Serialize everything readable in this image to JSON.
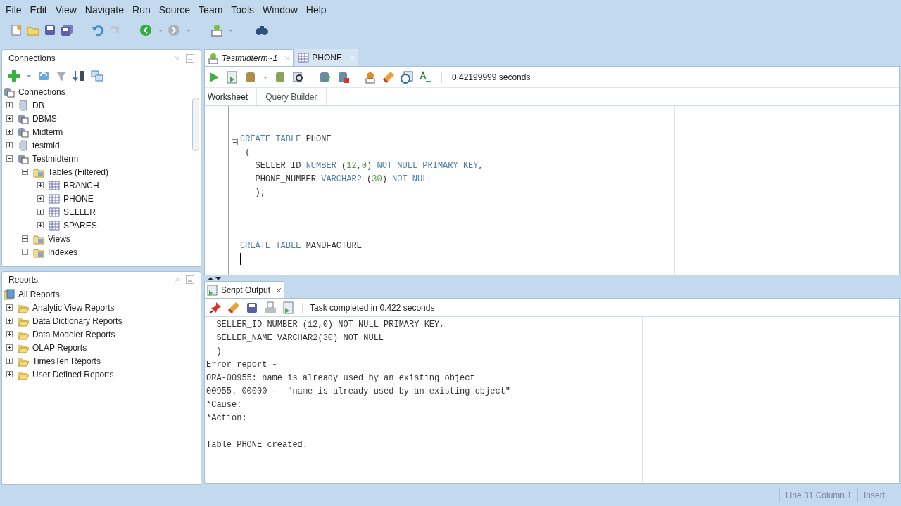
{
  "menu": [
    "File",
    "Edit",
    "View",
    "Navigate",
    "Run",
    "Source",
    "Team",
    "Tools",
    "Window",
    "Help"
  ],
  "connections_panel": {
    "title": "Connections",
    "tree": [
      {
        "label": "Connections",
        "kind": "conn",
        "children": [
          {
            "label": "DB",
            "kind": "db",
            "expanded": false
          },
          {
            "label": "DBMS",
            "kind": "conn",
            "expanded": false
          },
          {
            "label": "Midterm",
            "kind": "conn",
            "expanded": false
          },
          {
            "label": "testmid",
            "kind": "db",
            "expanded": false
          },
          {
            "label": "Testmidterm",
            "kind": "conn",
            "expanded": true,
            "children": [
              {
                "label": "Tables (Filtered)",
                "kind": "folder",
                "expanded": true,
                "children": [
                  {
                    "label": "BRANCH",
                    "kind": "table",
                    "expanded": false
                  },
                  {
                    "label": "PHONE",
                    "kind": "table",
                    "expanded": false
                  },
                  {
                    "label": "SELLER",
                    "kind": "table",
                    "expanded": false
                  },
                  {
                    "label": "SPARES",
                    "kind": "table",
                    "expanded": false
                  }
                ]
              },
              {
                "label": "Views",
                "kind": "folder",
                "expanded": false
              },
              {
                "label": "Indexes",
                "kind": "folder",
                "expanded": false
              }
            ]
          }
        ]
      }
    ]
  },
  "reports_panel": {
    "title": "Reports",
    "tree": [
      {
        "label": "All Reports",
        "kind": "reports",
        "children": [
          {
            "label": "Analytic View Reports",
            "kind": "open-folder",
            "expanded": false
          },
          {
            "label": "Data Dictionary Reports",
            "kind": "open-folder",
            "expanded": false
          },
          {
            "label": "Data Modeler Reports",
            "kind": "open-folder",
            "expanded": false
          },
          {
            "label": "OLAP Reports",
            "kind": "open-folder",
            "expanded": false
          },
          {
            "label": "TimesTen Reports",
            "kind": "open-folder",
            "expanded": false
          },
          {
            "label": "User Defined Reports",
            "kind": "open-folder",
            "expanded": false
          }
        ]
      }
    ]
  },
  "editor_tabs": [
    {
      "label": "Testmidterm~1",
      "kind": "sql",
      "selected": true
    },
    {
      "label": "PHONE",
      "kind": "table",
      "selected": false
    }
  ],
  "editor_toolbar": {
    "timing": "0.42199999 seconds"
  },
  "worksheet_tabs": [
    {
      "label": "Worksheet",
      "selected": true
    },
    {
      "label": "Query Builder",
      "selected": false
    }
  ],
  "code_lines": [
    {
      "kind": "blank"
    },
    {
      "kind": "blank"
    },
    {
      "kind": "code",
      "segments": [
        {
          "text": "CREATE TABLE ",
          "kind": "keyword"
        },
        {
          "text": "PHONE",
          "kind": "plain"
        }
      ]
    },
    {
      "kind": "code",
      "segments": [
        {
          "text": " (",
          "kind": "plain"
        }
      ]
    },
    {
      "kind": "code",
      "segments": [
        {
          "text": "   SELLER_ID ",
          "kind": "plain"
        },
        {
          "text": "NUMBER ",
          "kind": "keyword"
        },
        {
          "text": "(",
          "kind": "plain"
        },
        {
          "text": "12",
          "kind": "number"
        },
        {
          "text": ",",
          "kind": "plain"
        },
        {
          "text": "0",
          "kind": "number"
        },
        {
          "text": ") ",
          "kind": "plain"
        },
        {
          "text": "NOT NULL PRIMARY KEY",
          "kind": "keyword"
        },
        {
          "text": ",",
          "kind": "plain"
        }
      ]
    },
    {
      "kind": "code",
      "segments": [
        {
          "text": "   PHONE_NUMBER ",
          "kind": "plain"
        },
        {
          "text": "VARCHAR2 ",
          "kind": "keyword"
        },
        {
          "text": "(",
          "kind": "plain"
        },
        {
          "text": "30",
          "kind": "number"
        },
        {
          "text": ") ",
          "kind": "plain"
        },
        {
          "text": "NOT NULL",
          "kind": "keyword"
        }
      ]
    },
    {
      "kind": "code",
      "segments": [
        {
          "text": "   );",
          "kind": "plain"
        }
      ]
    },
    {
      "kind": "blank"
    },
    {
      "kind": "blank"
    },
    {
      "kind": "blank"
    },
    {
      "kind": "code",
      "segments": [
        {
          "text": "CREATE TABLE ",
          "kind": "keyword"
        },
        {
          "text": "MANUFACTURE",
          "kind": "plain"
        }
      ]
    }
  ],
  "output_tab": {
    "label": "Script Output"
  },
  "output_status": "Task completed in 0.422 seconds",
  "output_lines": [
    {
      "kind": "text",
      "text": "  SELLER_ID NUMBER (12,0) NOT NULL PRIMARY KEY,"
    },
    {
      "kind": "text",
      "text": "  SELLER_NAME VARCHAR2(30) NOT NULL"
    },
    {
      "kind": "text",
      "text": "  )"
    },
    {
      "kind": "text",
      "text": "Error report -"
    },
    {
      "kind": "text",
      "text": "ORA-00955: name is already used by an existing object"
    },
    {
      "kind": "text",
      "text": "00955. 00000 -  \"name is already used by an existing object\""
    },
    {
      "kind": "text",
      "text": "*Cause:"
    },
    {
      "kind": "text",
      "text": "*Action:"
    },
    {
      "kind": "blank"
    },
    {
      "kind": "text",
      "text": "Table PHONE created."
    }
  ],
  "status_bar": {
    "position": "Line 31 Column 1",
    "mode": "Insert"
  }
}
